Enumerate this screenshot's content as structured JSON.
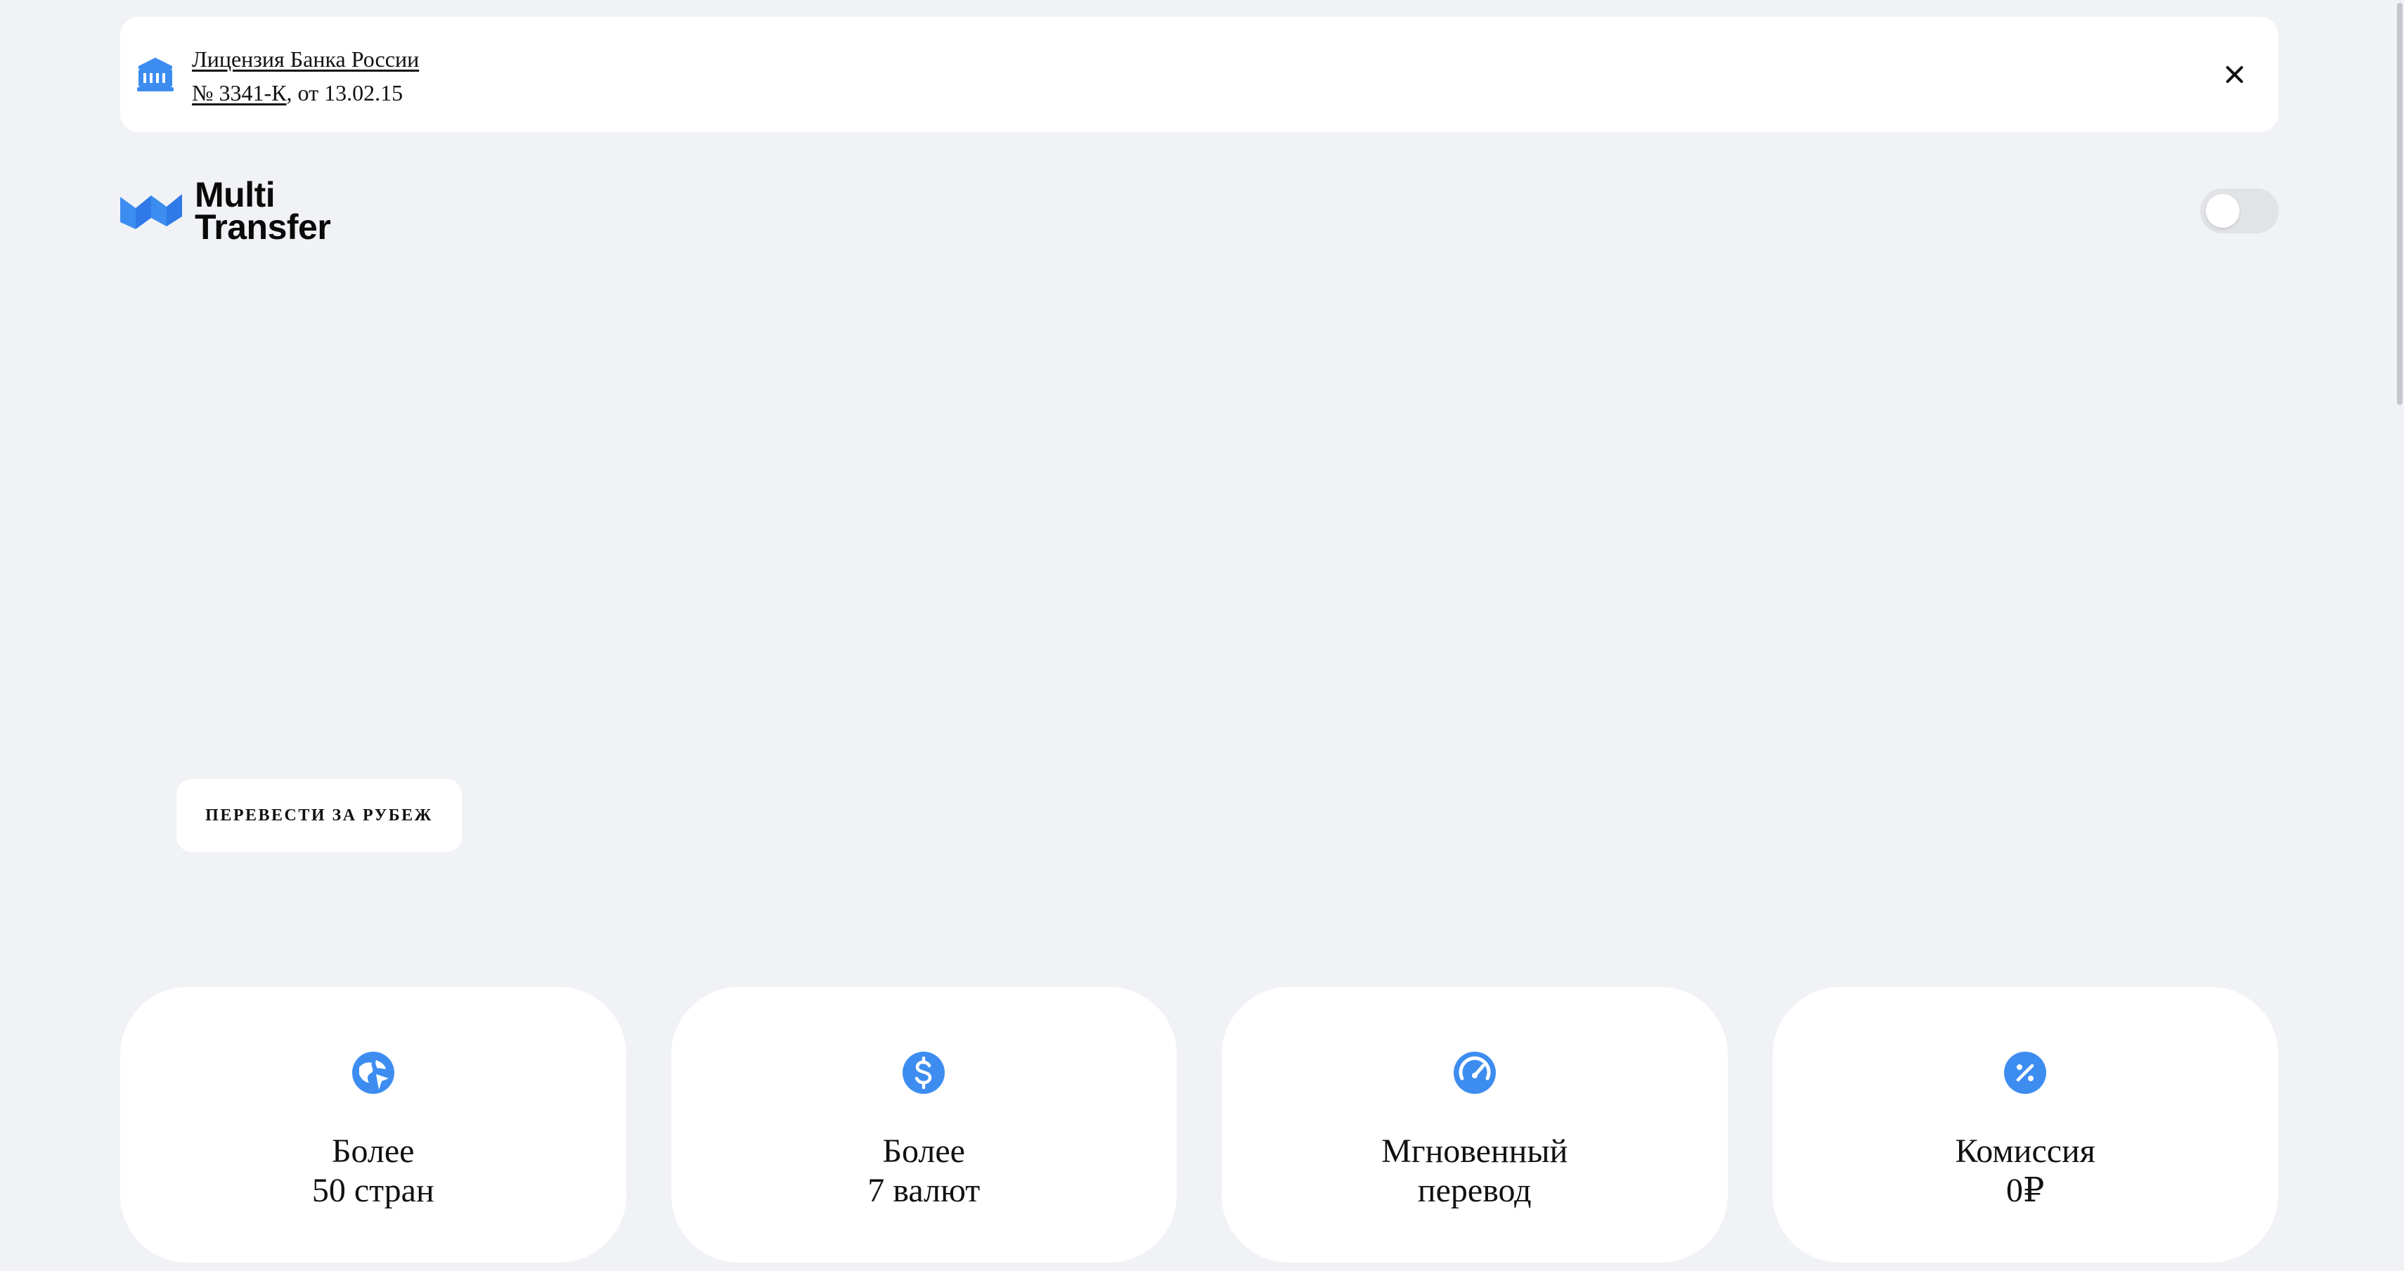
{
  "banner": {
    "line1_link": "Лицензия Банка России",
    "line2_link": "№ 3341-К",
    "line2_rest": ", от 13.02.15",
    "icon": "bank-icon",
    "close_icon": "close-icon"
  },
  "logo": {
    "line1": "Multi",
    "line2": "Transfer"
  },
  "theme_toggle": {
    "state": "off"
  },
  "cta": {
    "label": "ПЕРЕВЕСТИ ЗА РУБЕЖ"
  },
  "features": [
    {
      "icon": "globe-icon",
      "line1": "Более",
      "line2": "50 стран"
    },
    {
      "icon": "dollar-icon",
      "line1": "Более",
      "line2": "7 валют"
    },
    {
      "icon": "speedometer-icon",
      "line1": "Мгновенный",
      "line2": "перевод"
    },
    {
      "icon": "percent-icon",
      "line1": "Комиссия",
      "line2": "0₽"
    }
  ],
  "colors": {
    "accent": "#3d8df0",
    "background": "#f1f2f5",
    "card": "#ffffff",
    "toggle_track": "#e1e3e7"
  }
}
